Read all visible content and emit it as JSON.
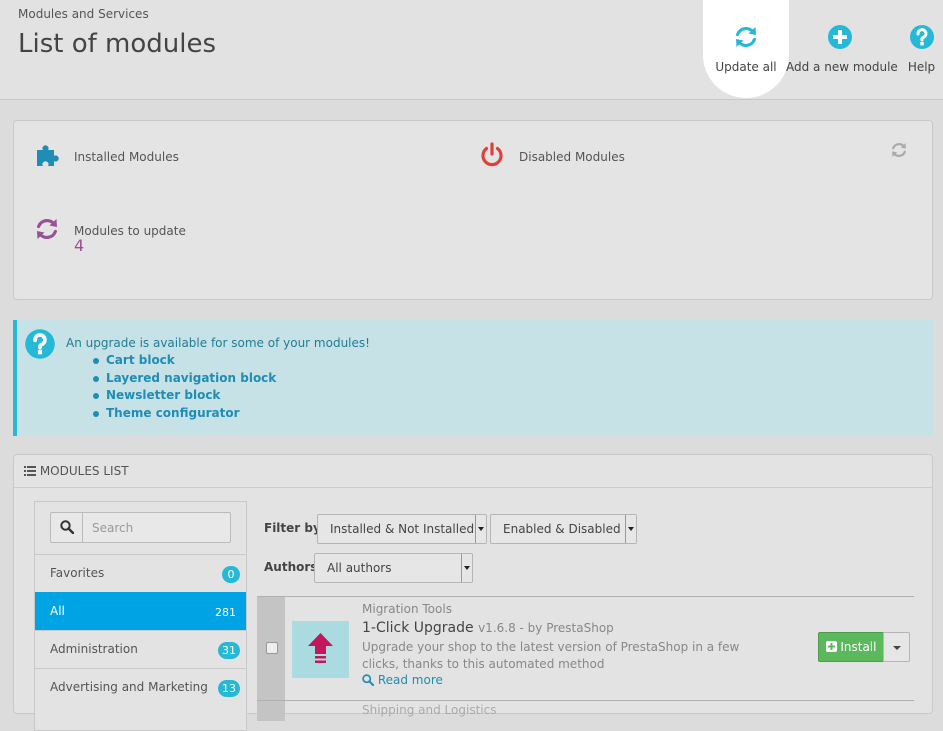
{
  "header": {
    "breadcrumb": "Modules and Services",
    "title": "List of modules",
    "toolbar": {
      "update_all": "Update all",
      "add_module": "Add a new module",
      "help": "Help"
    }
  },
  "kpis": {
    "installed": {
      "label": "Installed Modules",
      "icon": "puzzle-icon"
    },
    "disabled": {
      "label": "Disabled Modules",
      "icon": "power-icon"
    },
    "to_update": {
      "label": "Modules to update",
      "value": "4",
      "icon": "refresh-icon"
    }
  },
  "alert": {
    "message": "An upgrade is available for some of your modules!",
    "items": [
      "Cart block",
      "Layered navigation block",
      "Newsletter block",
      "Theme configurator"
    ]
  },
  "modules_list": {
    "heading": "MODULES LIST",
    "search_placeholder": "Search",
    "categories": [
      {
        "label": "Favorites",
        "count": "0"
      },
      {
        "label": "All",
        "count": "281"
      },
      {
        "label": "Administration",
        "count": "31"
      },
      {
        "label": "Advertising and Marketing",
        "count": "13"
      }
    ],
    "filter_by_label": "Filter by",
    "filter_install": "Installed & Not Installed",
    "filter_enabled": "Enabled & Disabled",
    "authors_label": "Authors",
    "authors_value": "All authors",
    "modules": [
      {
        "category": "Migration Tools",
        "name": "1-Click Upgrade",
        "version_author": "v1.6.8 - by PrestaShop",
        "description": "Upgrade your shop to the latest version of PrestaShop in a few clicks, thanks to this automated method",
        "read_more": "Read more",
        "install": "Install"
      }
    ],
    "next_category": "Shipping and Logistics"
  },
  "colors": {
    "accent": "#25b9d7",
    "active_category": "#00a4e4",
    "install": "#5cb85c",
    "kpi_value": "#9b4f96"
  }
}
